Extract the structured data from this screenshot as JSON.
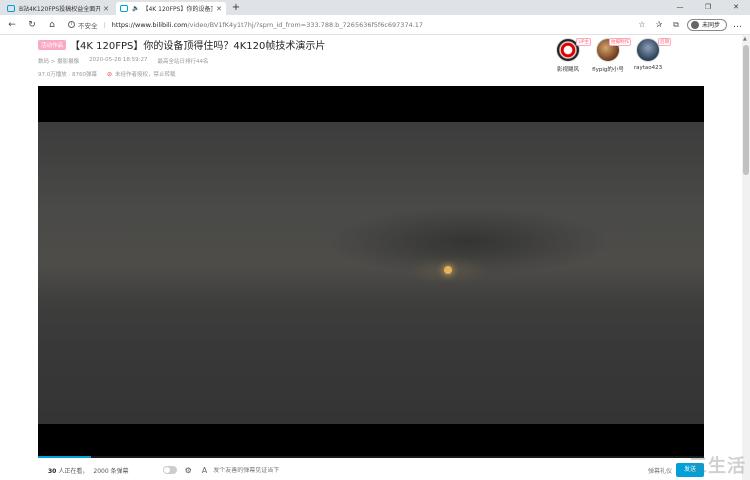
{
  "browser": {
    "tabs": [
      {
        "title": "B站4K120FPS投稿权益全面开放",
        "active": false
      },
      {
        "title": "【4K 120FPS】你的设备顶得",
        "active": true
      }
    ],
    "new_tab": "+",
    "window_buttons": [
      "—",
      "❐",
      "✕"
    ],
    "back": "←",
    "forward": "→",
    "refresh": "↻",
    "home": "⌂",
    "security_label": "不安全",
    "url_host": "https://www.bilibili.com",
    "url_path": "/video/BV1fK4y1t7hj/?spm_id_from=333.788.b_7265636f5f6c697374.17",
    "sync_label": "未同步",
    "more": "…"
  },
  "video": {
    "badge": "活动作品",
    "title": "【4K 120FPS】你的设备顶得住吗？4K120帧技术演示片",
    "category": "数码 > 摄影摄像",
    "date": "2020-05-28 18:59:27",
    "rank": "最高全站日排行44名",
    "plays": "97.0万播放 · 8760弹幕",
    "warning": "未经作者授权，禁止转载",
    "progress": 0.08
  },
  "uploaders": [
    {
      "name": "影视飓风",
      "tag": "UP主"
    },
    {
      "name": "flypig的小号",
      "tag": "拍摄制作"
    },
    {
      "name": "raytao423",
      "tag": "后期"
    }
  ],
  "danmaku": {
    "viewers_count": "30",
    "viewers_label": "人正在看，",
    "dm_count": "2000 条弹幕",
    "input_placeholder": "发个友善的弹幕见证当下",
    "etiquette": "弹幕礼仪",
    "send": "发送"
  },
  "watermark": "三生活"
}
